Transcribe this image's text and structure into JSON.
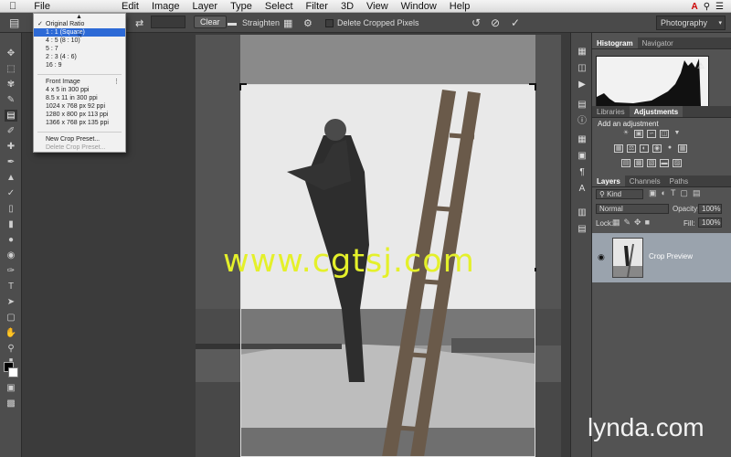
{
  "menubar": {
    "app_menu": "",
    "items": [
      "File",
      "Edit",
      "Image",
      "Layer",
      "Type",
      "Select",
      "Filter",
      "3D",
      "View",
      "Window",
      "Help"
    ]
  },
  "options": {
    "clear_label": "Clear",
    "straighten_label": "Straighten",
    "delete_cropped_label": "Delete Cropped Pixels",
    "workspace_value": "Photography"
  },
  "crop_presets": {
    "items": [
      {
        "label": "Original Ratio",
        "checked": true,
        "disabled": false
      },
      {
        "label": "1 : 1 (Square)",
        "selected": true,
        "disabled": false
      },
      {
        "label": "4 : 5 (8 : 10)",
        "disabled": false
      },
      {
        "label": "5 : 7",
        "disabled": false
      },
      {
        "label": "2 : 3 (4 : 6)",
        "disabled": false
      },
      {
        "label": "16 : 9",
        "disabled": false
      }
    ],
    "front_image_label": "Front Image",
    "size_items": [
      "4 x 5 in 300 ppi",
      "8.5 x 11 in 300 ppi",
      "1024 x 768 px 92 ppi",
      "1280 x 800 px 113 ppi",
      "1366 x 768 px 135 ppi"
    ],
    "new_preset_label": "New Crop Preset...",
    "delete_preset_label": "Delete Crop Preset..."
  },
  "panels": {
    "histogram_tabs": [
      "Histogram",
      "Navigator"
    ],
    "adjust_tabs": [
      "Libraries",
      "Adjustments"
    ],
    "add_adjustment_label": "Add an adjustment",
    "layer_tabs": [
      "Layers",
      "Channels",
      "Paths"
    ],
    "kind_label": "Kind",
    "blend_mode": "Normal",
    "opacity_label": "Opacity:",
    "opacity_value": "100%",
    "lock_label": "Lock:",
    "fill_label": "Fill:",
    "fill_value": "100%",
    "layer_name": "Crop Preview"
  },
  "watermark": "www.cgtsj.com",
  "brand": "lynda.com"
}
